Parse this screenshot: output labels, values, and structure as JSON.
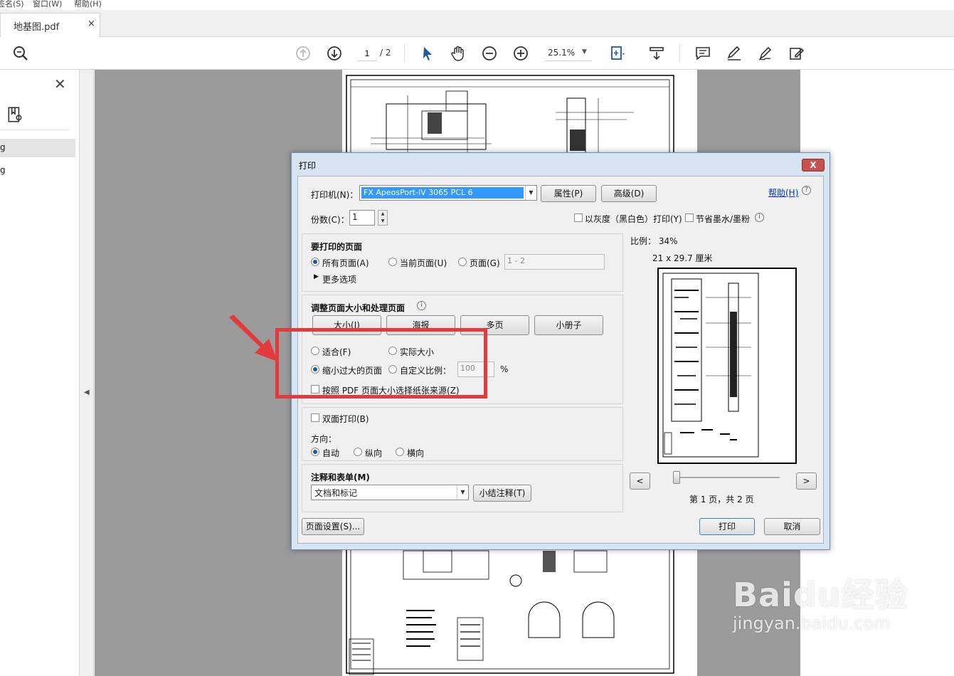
{
  "menu": {
    "items": [
      "签名(S)",
      "窗口(W)",
      "帮助(H)"
    ]
  },
  "tab": {
    "title": "地基图.pdf",
    "close": "×"
  },
  "toolbar": {
    "current_page": "1",
    "total_pages": "/ 2",
    "zoom": "25.1%",
    "icons": [
      "search-icon",
      "page-up-icon",
      "page-down-icon",
      "select-cursor-icon",
      "hand-icon",
      "zoom-out-icon",
      "zoom-in-icon",
      "fit-page-icon",
      "scroll-mode-icon",
      "comment-icon",
      "highlight-icon",
      "sign-icon",
      "fill-sign-icon"
    ]
  },
  "left_panel": {
    "close": "✕",
    "items": [
      "g",
      "g"
    ]
  },
  "dialog": {
    "title": "打印",
    "close": "X",
    "help": "帮助(H)",
    "printer_label": "打印机(N)：",
    "printer_value": "FX ApeosPort-IV 3065 PCL 6",
    "properties_btn": "属性(P)",
    "advanced_btn": "高级(D)",
    "copies_label": "份数(C)：",
    "copies_value": "1",
    "grayscale_label": "以灰度（黑白色）打印(Y)",
    "save_ink_label": "节省墨水/墨粉",
    "pages_section": {
      "title": "要打印的页面",
      "all_pages": "所有页面(A)",
      "current_page": "当前页面(U)",
      "pages": "页面(G)",
      "pages_value": "1 - 2",
      "more_options": "更多选项"
    },
    "sizing_section": {
      "title": "调整页面大小和处理页面",
      "size_btn": "大小(I)",
      "poster_btn": "海报",
      "multiple_btn": "多页",
      "booklet_btn": "小册子",
      "fit": "适合(F)",
      "actual_size": "实际大小",
      "shrink": "缩小过大的页面",
      "custom_scale": "自定义比例：",
      "custom_value": "100",
      "percent": "%",
      "paper_source": "按照 PDF 页面大小选择纸张来源(Z)"
    },
    "duplex_label": "双面打印(B)",
    "orientation": {
      "label": "方向：",
      "auto": "自动",
      "portrait": "纵向",
      "landscape": "横向"
    },
    "comments": {
      "title": "注释和表单(M)",
      "value": "文档和标记",
      "summarize_btn": "小结注释(T)"
    },
    "preview": {
      "scale": "比例： 34%",
      "size": "21 x 29.7 厘米",
      "prev": "<",
      "next": ">",
      "page_info": "第 1 页，共 2 页"
    },
    "page_setup_btn": "页面设置(S)...",
    "print_btn": "打印",
    "cancel_btn": "取消",
    "selected": {
      "pages": "all_pages",
      "sizing": "shrink",
      "orientation": "auto"
    }
  },
  "watermark": {
    "logo": "Baidu经验",
    "url": "jingyan.baidu.com"
  },
  "colors": {
    "highlight_box": "#e33b3b",
    "accent": "#1f5aa0",
    "selection": "#3399ff"
  }
}
